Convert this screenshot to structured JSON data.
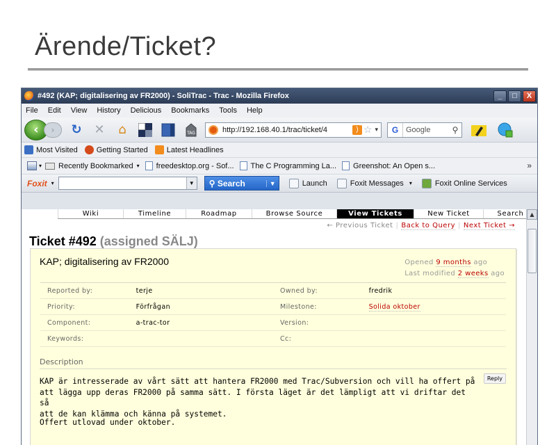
{
  "slide": {
    "title": "Ärende/Ticket?"
  },
  "window": {
    "title": "#492 (KAP; digitalisering av FR2000) - SoliTrac - Trac - Mozilla Firefox",
    "buttons": [
      "_",
      "□",
      "X"
    ]
  },
  "menu": [
    "File",
    "Edit",
    "View",
    "History",
    "Delicious",
    "Bookmarks",
    "Tools",
    "Help"
  ],
  "navbar": {
    "url": "http://192.168.40.1/trac/ticket/4",
    "search_placeholder": "Google",
    "search_engine": "G",
    "icons": [
      "back-icon",
      "forward-icon",
      "reload-icon",
      "stop-icon",
      "home-icon",
      "delicious-icon",
      "bookmark-icon",
      "tag-icon",
      "rss-icon",
      "star-icon",
      "highlighter-icon",
      "addon-icon"
    ]
  },
  "bookmarks": [
    {
      "label": "Most Visited",
      "color": "#3b6fc4"
    },
    {
      "label": "Getting Started",
      "color": "#d44a1a"
    },
    {
      "label": "Latest Headlines",
      "color": "#f28c1c"
    }
  ],
  "recent": {
    "items": [
      "Recently Bookmarked",
      "freedesktop.org - Sof...",
      "The C Programming La...",
      "Greenshot: An Open s..."
    ],
    "more": "»"
  },
  "foxit": {
    "logo": "Foxit",
    "search": "Search",
    "launch": "Launch",
    "messages": "Foxit Messages",
    "online": "Foxit Online Services"
  },
  "trac": {
    "nav": [
      {
        "label": "Wiki",
        "width": 94
      },
      {
        "label": "Timeline",
        "width": 90
      },
      {
        "label": "Roadmap",
        "width": 95
      },
      {
        "label": "Browse Source",
        "width": 122
      },
      {
        "label": "View Tickets",
        "width": 111,
        "active": true
      },
      {
        "label": "New Ticket",
        "width": 100
      },
      {
        "label": "Search",
        "width": 78
      }
    ],
    "ticket_nav": {
      "previous": "← Previous Ticket",
      "back": "Back to Query",
      "next": "Next Ticket →"
    },
    "heading": "Ticket #492",
    "status": "(assigned SÄLJ)",
    "summary": "KAP; digitalisering av FR2000",
    "opened_prefix": "Opened",
    "opened": "9 months",
    "modified_prefix": "Last modified",
    "modified": "2 weeks",
    "ago": "ago",
    "properties": [
      {
        "k1": "Reported by:",
        "v1": "terje",
        "k2": "Owned by:",
        "v2": "fredrik"
      },
      {
        "k1": "Priority:",
        "v1": "Förfrågan",
        "k2": "Milestone:",
        "v2": "Solida oktober",
        "v2link": true
      },
      {
        "k1": "Component:",
        "v1": "a-trac-tor",
        "k2": "Version:",
        "v2": ""
      },
      {
        "k1": "Keywords:",
        "v1": "",
        "k2": "Cc:",
        "v2": ""
      }
    ],
    "description_label": "Description",
    "reply": "Reply",
    "description": "KAP är intresserade av vårt sätt att hantera FR2000 med Trac/Subversion och vill ha offert på\natt lägga upp deras FR2000 på samma sätt. I första läget är det lämpligt att vi driftar det så\natt de kan klämma och känna på systemet.",
    "description2": "Offert utlovad under oktober."
  }
}
